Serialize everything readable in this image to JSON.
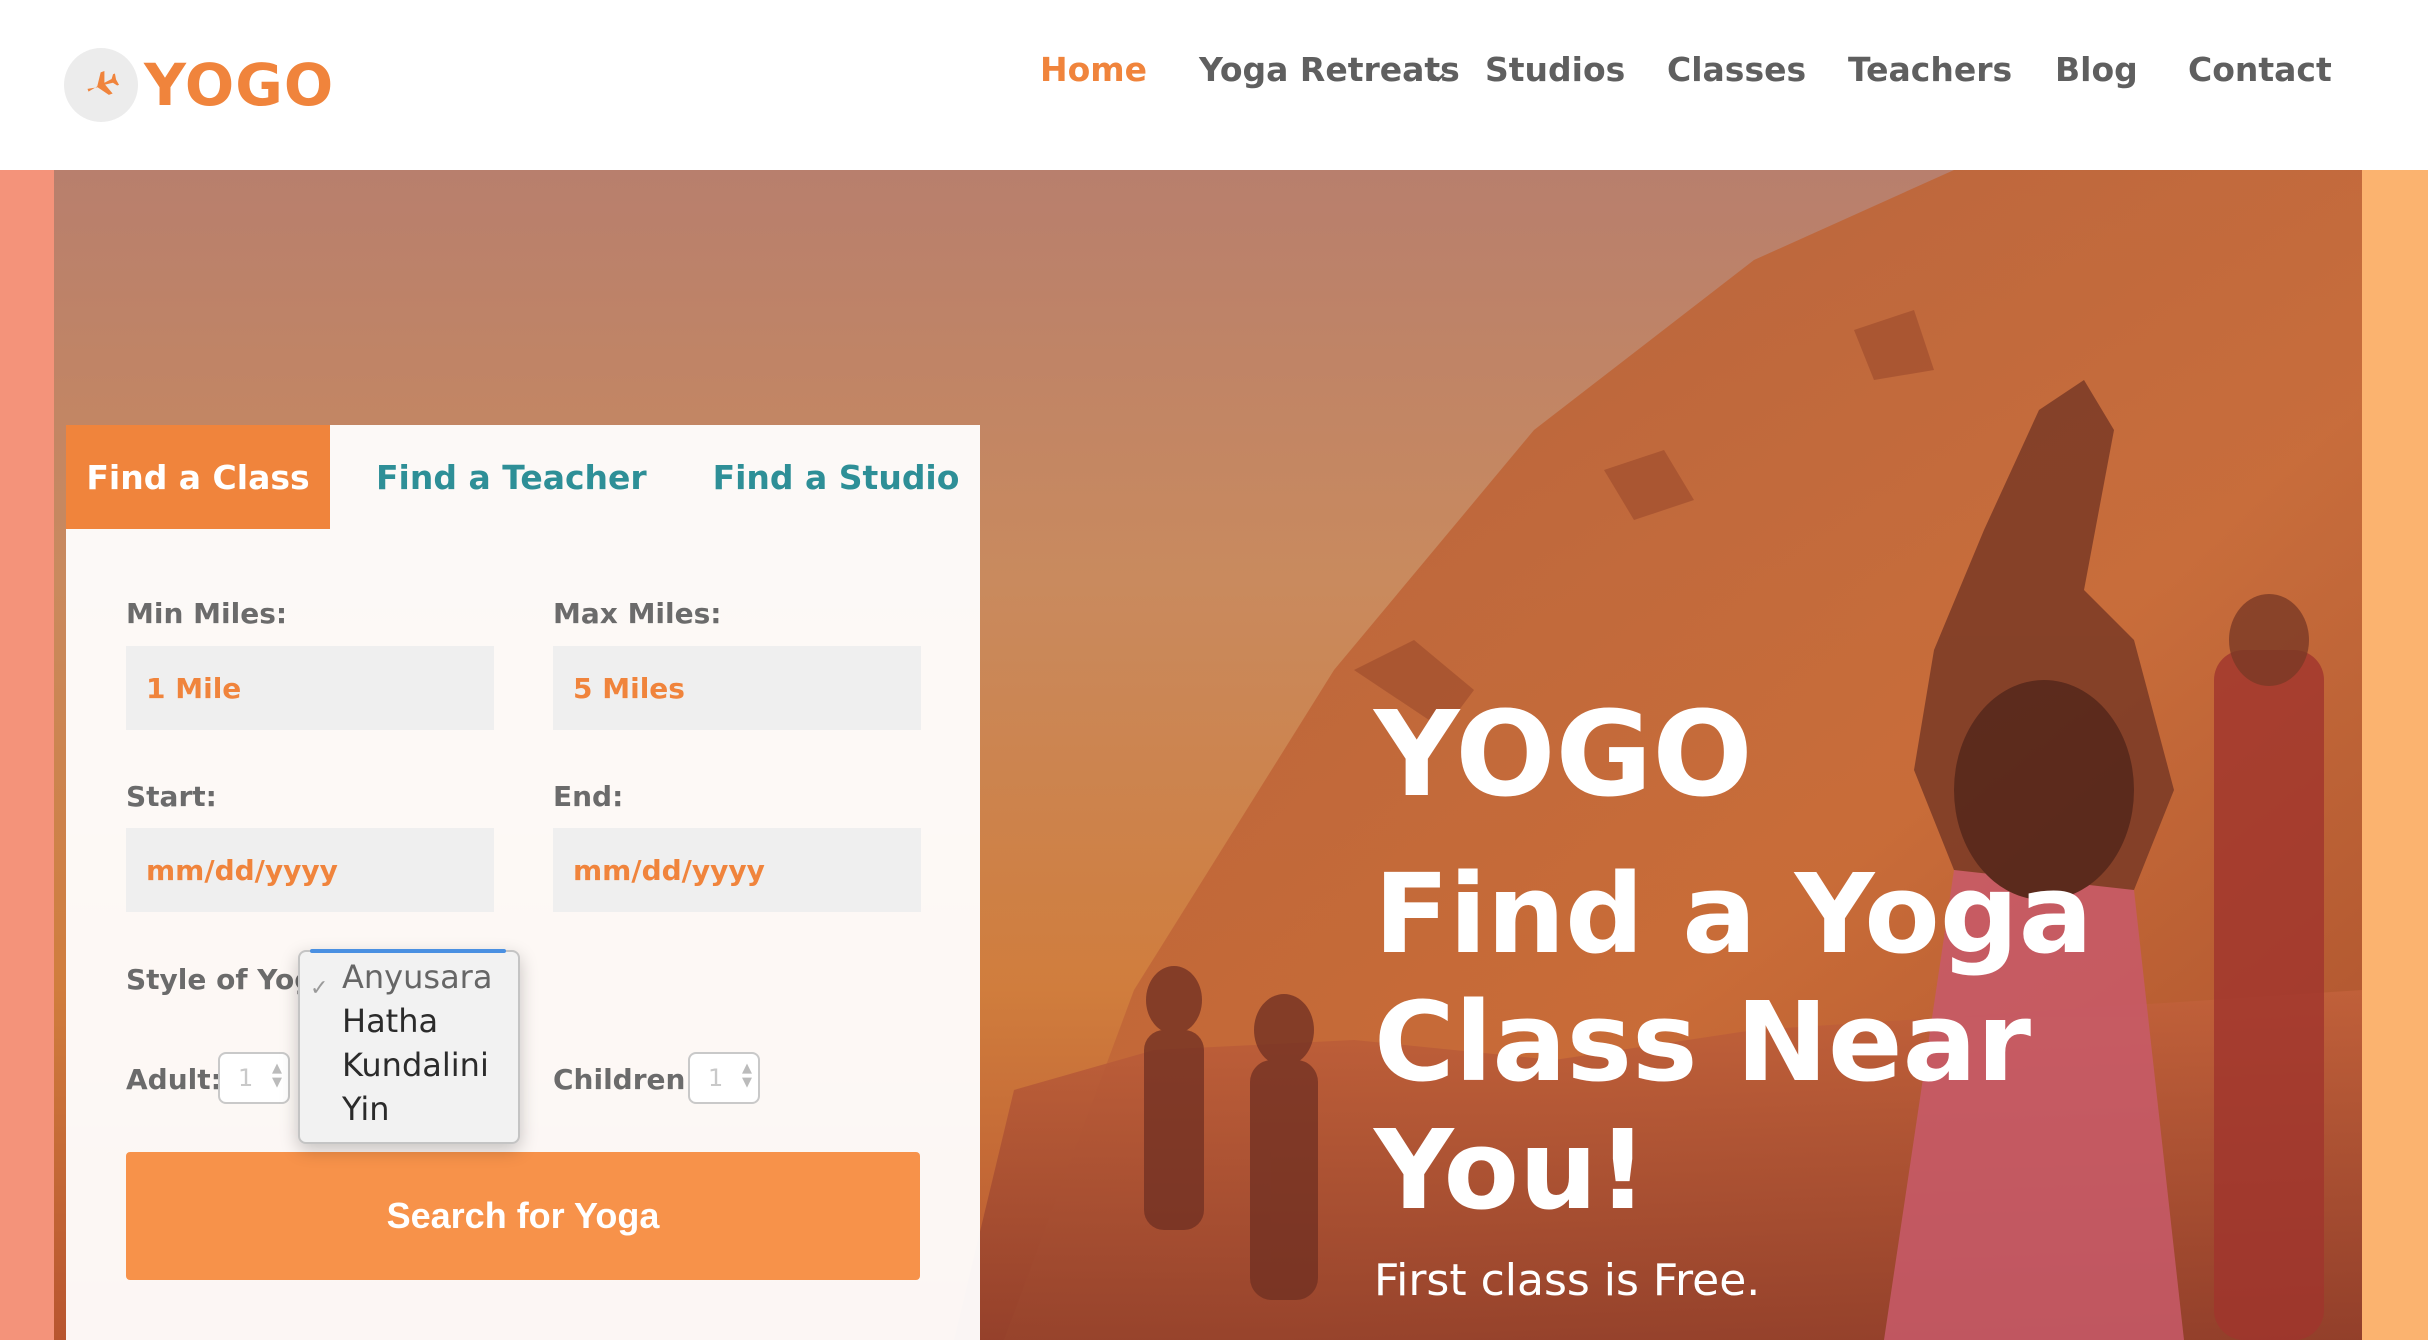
{
  "logo": {
    "text": "YOGO",
    "icon": "airplane-icon"
  },
  "nav": {
    "items": [
      {
        "label": "Home",
        "active": true
      },
      {
        "label": "Yoga Retreats",
        "has_dropdown": true
      },
      {
        "label": "Studios"
      },
      {
        "label": "Classes"
      },
      {
        "label": "Teachers"
      },
      {
        "label": "Blog"
      },
      {
        "label": "Contact"
      }
    ]
  },
  "hero": {
    "title": "YOGO",
    "headline": "Find a Yoga Class Near You!",
    "subtitle": "First class is Free."
  },
  "search": {
    "tabs": [
      {
        "label": "Find a Class",
        "active": true
      },
      {
        "label": "Find a Teacher"
      },
      {
        "label": "Find a Studio"
      }
    ],
    "min_miles": {
      "label": "Min Miles:",
      "value": "1 Mile"
    },
    "max_miles": {
      "label": "Max Miles:",
      "value": "5 Miles"
    },
    "start": {
      "label": "Start:",
      "placeholder": "mm/dd/yyyy"
    },
    "end": {
      "label": "End:",
      "placeholder": "mm/dd/yyyy"
    },
    "style": {
      "label": "Style of Yoga",
      "options": [
        "Anyusara",
        "Hatha",
        "Kundalini",
        "Yin"
      ],
      "selected": "Anyusara",
      "check": "✓"
    },
    "adult": {
      "label": "Adult:",
      "value": "1"
    },
    "children": {
      "label": "Children:",
      "value": "1"
    },
    "button_label": "Search for Yoga"
  },
  "colors": {
    "accent": "#f0843c",
    "button": "#f7924a",
    "tab_text": "#2e8f97",
    "nav_text": "#5f5f5f"
  }
}
